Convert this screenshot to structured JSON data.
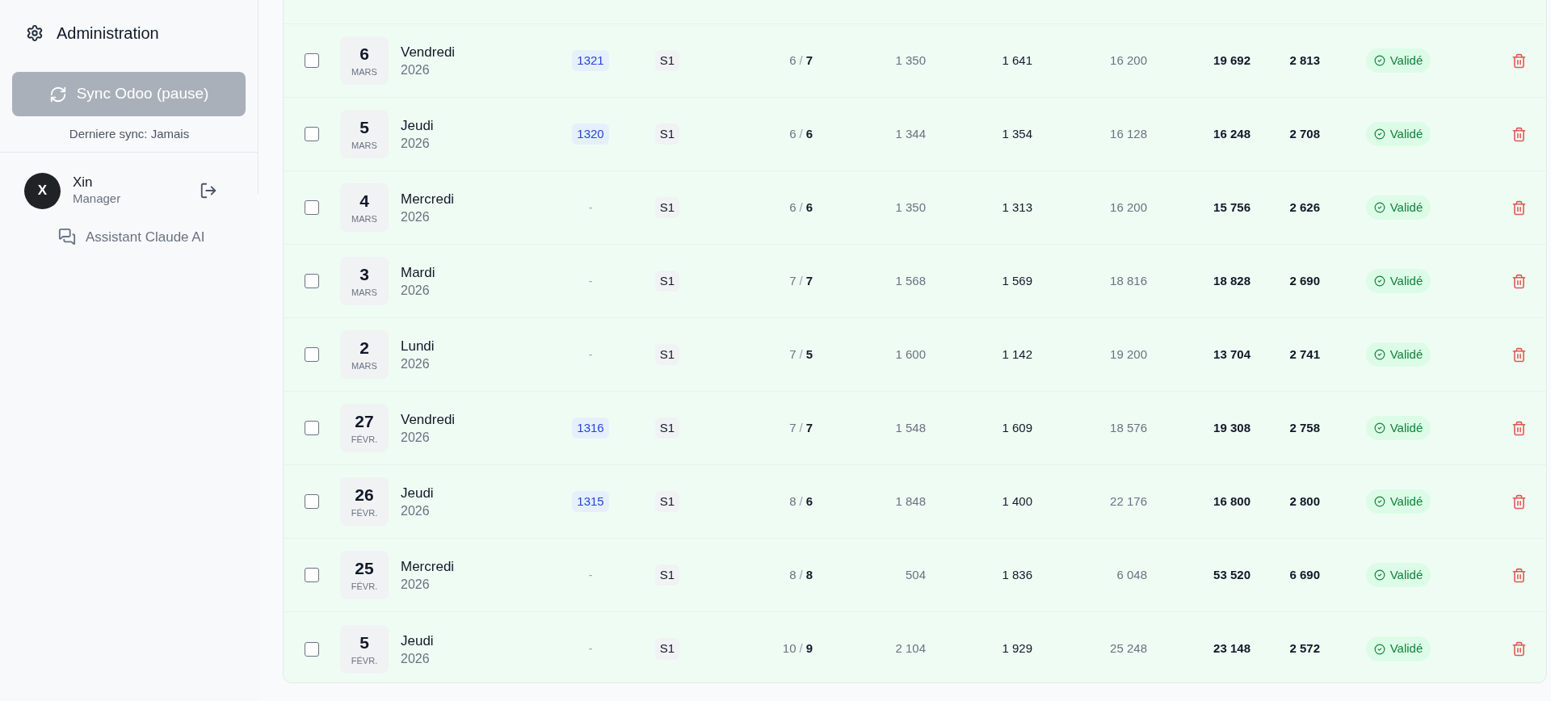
{
  "sidebar": {
    "admin_label": "Administration",
    "sync_button": {
      "label": "Sync Odoo (pause)",
      "disabled": true
    },
    "last_sync": "Derniere sync: Jamais",
    "user": {
      "initial": "X",
      "name": "Xin",
      "role": "Manager"
    },
    "assistant_link": "Assistant Claude AI"
  },
  "rows": [
    {
      "checked": false,
      "day": "6",
      "month": "MARS",
      "weekday": "Vendredi",
      "year": "2026",
      "ref": "1321",
      "linked": true,
      "tag": "S1",
      "ratio_a": "6",
      "ratio_sep": "/",
      "ratio_b": "7",
      "values": [
        "1 350",
        "1 641",
        "16 200",
        "19 692",
        "2 813"
      ],
      "status": "Validé"
    },
    {
      "checked": false,
      "day": "5",
      "month": "MARS",
      "weekday": "Jeudi",
      "year": "2026",
      "ref": "1320",
      "linked": true,
      "tag": "S1",
      "ratio_a": "6",
      "ratio_sep": "/",
      "ratio_b": "6",
      "values": [
        "1 344",
        "1 354",
        "16 128",
        "16 248",
        "2 708"
      ],
      "status": "Validé"
    },
    {
      "checked": false,
      "day": "4",
      "month": "MARS",
      "weekday": "Mercredi",
      "year": "2026",
      "ref": "-",
      "linked": false,
      "tag": "S1",
      "ratio_a": "6",
      "ratio_sep": "/",
      "ratio_b": "6",
      "values": [
        "1 350",
        "1 313",
        "16 200",
        "15 756",
        "2 626"
      ],
      "status": "Validé"
    },
    {
      "checked": false,
      "day": "3",
      "month": "MARS",
      "weekday": "Mardi",
      "year": "2026",
      "ref": "-",
      "linked": false,
      "tag": "S1",
      "ratio_a": "7",
      "ratio_sep": "/",
      "ratio_b": "7",
      "values": [
        "1 568",
        "1 569",
        "18 816",
        "18 828",
        "2 690"
      ],
      "status": "Validé"
    },
    {
      "checked": false,
      "day": "2",
      "month": "MARS",
      "weekday": "Lundi",
      "year": "2026",
      "ref": "-",
      "linked": false,
      "tag": "S1",
      "ratio_a": "7",
      "ratio_sep": "/",
      "ratio_b": "5",
      "values": [
        "1 600",
        "1 142",
        "19 200",
        "13 704",
        "2 741"
      ],
      "status": "Validé"
    },
    {
      "checked": false,
      "day": "27",
      "month": "FÉVR.",
      "weekday": "Vendredi",
      "year": "2026",
      "ref": "1316",
      "linked": true,
      "tag": "S1",
      "ratio_a": "7",
      "ratio_sep": "/",
      "ratio_b": "7",
      "values": [
        "1 548",
        "1 609",
        "18 576",
        "19 308",
        "2 758"
      ],
      "status": "Validé"
    },
    {
      "checked": false,
      "day": "26",
      "month": "FÉVR.",
      "weekday": "Jeudi",
      "year": "2026",
      "ref": "1315",
      "linked": true,
      "tag": "S1",
      "ratio_a": "8",
      "ratio_sep": "/",
      "ratio_b": "6",
      "values": [
        "1 848",
        "1 400",
        "22 176",
        "16 800",
        "2 800"
      ],
      "status": "Validé"
    },
    {
      "checked": false,
      "day": "25",
      "month": "FÉVR.",
      "weekday": "Mercredi",
      "year": "2026",
      "ref": "-",
      "linked": false,
      "tag": "S1",
      "ratio_a": "8",
      "ratio_sep": "/",
      "ratio_b": "8",
      "values": [
        "504",
        "1 836",
        "6 048",
        "53 520",
        "6 690"
      ],
      "status": "Validé"
    },
    {
      "checked": false,
      "day": "5",
      "month": "FÉVR.",
      "weekday": "Jeudi",
      "year": "2026",
      "ref": "-",
      "linked": false,
      "tag": "S1",
      "ratio_a": "10",
      "ratio_sep": "/",
      "ratio_b": "9",
      "values": [
        "2 104",
        "1 929",
        "25 248",
        "23 148",
        "2 572"
      ],
      "status": "Validé"
    }
  ]
}
